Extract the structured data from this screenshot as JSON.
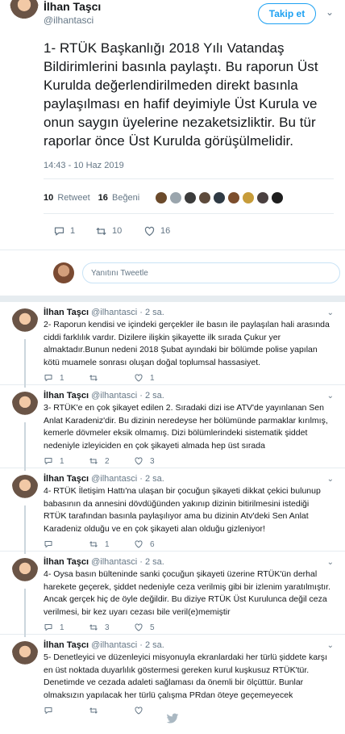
{
  "main_tweet": {
    "name": "İlhan Taşcı",
    "handle": "@ilhantasci",
    "follow_label": "Takip et",
    "text": "1- RTÜK Başkanlığı 2018 Yılı Vatandaş Bildirimlerini basınla paylaştı. Bu raporun Üst Kurulda değerlendirilmeden direkt basınla paylaşılması en hafif deyimiyle Üst Kurula ve onun saygın üyelerine nezaketsizliktir. Bu tür raporlar önce Üst Kurulda görüşülmelidir.",
    "time": "14:43 - 10 Haz 2019",
    "retweet_count": "10",
    "retweet_label": "Retweet",
    "like_count": "16",
    "like_label": "Beğeni",
    "actions": {
      "reply": "1",
      "retweet": "10",
      "like": "16"
    }
  },
  "reply_box": {
    "placeholder": "Yanıtını Tweetle"
  },
  "thread": [
    {
      "name": "İlhan Taşcı",
      "handle": "@ilhantasci",
      "time": "2 sa.",
      "text": "2- Raporun kendisi ve içindeki gerçekler ile basın ile paylaşılan hali arasında ciddi farklılık vardır. Dizilere ilişkin şikayette ilk sırada Çukur yer almaktadır.Bunun nedeni 2018 Şubat ayındaki bir bölümde polise yapılan kötü muamele sonrası oluşan doğal toplumsal hassasiyet.",
      "reply": "1",
      "retweet": "",
      "like": "1"
    },
    {
      "name": "İlhan Taşcı",
      "handle": "@ilhantasci",
      "time": "2 sa.",
      "text": "3- RTÜK'e en çok şikayet edilen 2. Sıradaki dizi ise ATV'de yayınlanan Sen Anlat Karadeniz'dir. Bu dizinin neredeyse her bölümünde parmaklar kırılmış, kemerle dövmeler eksik olmamış. Dizi bölümlerindeki sistematik şiddet nedeniyle izleyiciden en çok şikayeti almada hep üst sırada",
      "reply": "1",
      "retweet": "2",
      "like": "3"
    },
    {
      "name": "İlhan Taşcı",
      "handle": "@ilhantasci",
      "time": "2 sa.",
      "text": "4- RTÜK İletişim Hattı'na ulaşan bir çocuğun şikayeti dikkat çekici bulunup babasının da annesini dövdüğünden yakınıp dizinin bitirilmesini istediği RTÜK tarafından basınla paylaşılıyor ama bu dizinin Atv'deki Sen Anlat Karadeniz olduğu ve en çok şikayeti alan olduğu gizleniyor!",
      "reply": "",
      "retweet": "1",
      "like": "6"
    },
    {
      "name": "İlhan Taşcı",
      "handle": "@ilhantasci",
      "time": "2 sa.",
      "text": "4- Oysa basın bülteninde sanki çocuğun şikayeti üzerine RTÜK'ün derhal harekete geçerek, şiddet nedeniyle ceza verilmiş gibi bir izlenim yaratılmıştır. Ancak gerçek hiç de öyle değildir. Bu diziye RTÜK Üst Kurulunca değil ceza verilmesi, bir kez uyarı cezası bile veril(e)memiştir",
      "reply": "1",
      "retweet": "3",
      "like": "5"
    },
    {
      "name": "İlhan Taşcı",
      "handle": "@ilhantasci",
      "time": "2 sa.",
      "text": "5- Denetleyici ve düzenleyici misyonuyla ekranlardaki her türlü şiddete karşı en üst noktada duyarlılık göstermesi gereken kurul kuşkusuz RTÜK'tür. Denetimde ve cezada adaleti sağlaması da önemli bir ölçüttür. Bunlar olmaksızın yapılacak her türlü çalışma PRdan öteye geçemeyecek",
      "reply": "",
      "retweet": "",
      "like": ""
    }
  ],
  "colors": {
    "brand": "#1da1f2",
    "muted": "#657786",
    "text": "#14171a"
  },
  "icons": [
    "reply-icon",
    "retweet-icon",
    "like-icon",
    "twitter-bird-icon",
    "chevron-down-icon"
  ]
}
